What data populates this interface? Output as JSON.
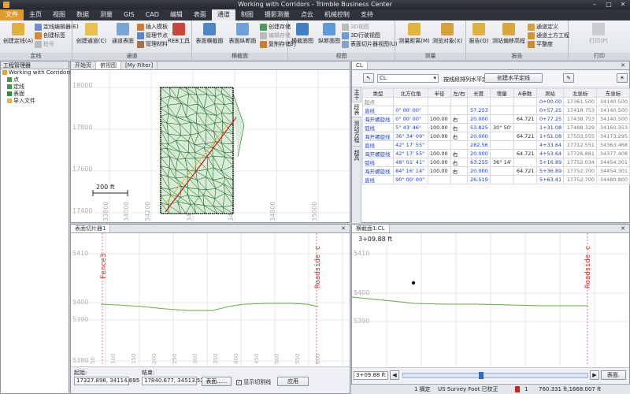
{
  "window": {
    "title": "Working with Corridors - Trimble Business Center"
  },
  "menu": {
    "file": "文件",
    "tabs": [
      "主页",
      "视图",
      "数据",
      "测量",
      "GIS",
      "CAD",
      "编辑",
      "表面",
      "通道",
      "制图",
      "摄影测量",
      "点云",
      "机械控制",
      "支持"
    ],
    "active": "通道"
  },
  "ribbon": {
    "groups": {
      "definition": "定线",
      "corridor": "通道",
      "cross_section": "横截面",
      "view": "视图",
      "survey": "测量",
      "report": "报告",
      "print": "打印"
    },
    "create_alignment": "创建定线(A)",
    "alignment_editor": "定线编辑器(E)",
    "create_label": "创建标签",
    "station": "桩号",
    "create_corridor": "创建通道(C)",
    "corridor_surface": "通道表面",
    "insert_template": "插入模板",
    "manage_nodes": "管理节点",
    "manage_materials": "管理材料",
    "reb_tool": "REB工具",
    "cs_view_surface": "表面横截面",
    "cs_view_corridor": "表面纵断面",
    "create_storage": "创建存储",
    "edit_storage": "编辑存储",
    "copy_storage": "复制存储的",
    "view_cross": "横截面图",
    "view_profile": "纵断面图",
    "view_3d": "3D视图",
    "view_3d_walk": "3D行驶视图",
    "view_surface_slice": "表面切片器视图(U)",
    "survey_distance": "测量距离(M)",
    "survey_target": "测览对象(X)",
    "report_btn": "报告(O)",
    "report_elevation": "测站偏移高程",
    "report_corridor_def": "通道定义",
    "report_earthworks": "通道土方工程",
    "report_flat": "平整度",
    "print_btn": "打印(P)"
  },
  "explorer": {
    "title": "工程管理器",
    "items": [
      "Working with Corridors",
      "点",
      "定线",
      "表面",
      "导入文件"
    ]
  },
  "plan_view": {
    "tabs": [
      "开始页",
      "俯视图",
      "[My Filter]"
    ],
    "scale_label": "200 ft",
    "y_ticks": [
      "18000",
      "17800",
      "17600",
      "17400"
    ],
    "x_ticks": [
      "33800",
      "34000",
      "34200",
      "34400",
      "34600",
      "34800",
      "35000"
    ]
  },
  "properties": {
    "tab": "CL",
    "alignment_selector": "CL",
    "sort_button": "按线段排列水平定线",
    "create_button": "创建水平定线",
    "side_tabs": [
      "主干",
      "段表",
      "测站方程",
      "超高"
    ],
    "columns": [
      "类型",
      "北方位角",
      "半径",
      "左/右",
      "长度",
      "增量",
      "A参数",
      "测站",
      "北坐标",
      "东坐标"
    ],
    "rows": [
      [
        "起点",
        "",
        "",
        "",
        "",
        "",
        "",
        "0+00.00",
        "17361.500",
        "34140.500"
      ],
      [
        "直线",
        "0° 00' 00\"",
        "",
        "",
        "57.253",
        "",
        "",
        "0+57.25",
        "17418.753",
        "34140.500"
      ],
      [
        "海开螺旋线",
        "0° 00' 00\"",
        "100.00",
        "右",
        "20.000",
        "",
        "64.721",
        "0+77.25",
        "17438.753",
        "34140.500"
      ],
      [
        "弧线",
        "5° 43' 46\"",
        "100.00",
        "右",
        "53.825",
        "30° 50'",
        "",
        "1+31.08",
        "17488.329",
        "34160.353"
      ],
      [
        "海开螺旋线",
        "36° 34' 09\"",
        "100.00",
        "右",
        "20.000",
        "",
        "64.721",
        "1+51.08",
        "17503.555",
        "34173.295"
      ],
      [
        "直线",
        "42° 17' 55\"",
        "",
        "",
        "282.56",
        "",
        "",
        "4+33.64",
        "17712.551",
        "34363.468"
      ],
      [
        "海开螺旋线",
        "42° 17' 55\"",
        "100.00",
        "右",
        "20.000",
        "",
        "64.721",
        "4+53.64",
        "17726.881",
        "34377.408"
      ],
      [
        "弧线",
        "48° 01' 41\"",
        "100.00",
        "右",
        "63.255",
        "36° 14'",
        "",
        "5+16.89",
        "17752.034",
        "34454.301"
      ],
      [
        "海开螺旋线",
        "84° 16' 14\"",
        "100.00",
        "右",
        "20.000",
        "",
        "64.721",
        "5+36.89",
        "17752.700",
        "34454.301"
      ],
      [
        "直线",
        "90° 00' 00\"",
        "",
        "",
        "26.519",
        "",
        "",
        "5+63.41",
        "17752.700",
        "34480.800"
      ]
    ]
  },
  "cross_section": {
    "tab": "表面切片器1",
    "y_ticks": [
      "5410",
      "5400",
      "5390",
      "5380"
    ],
    "x_ticks": [
      "50",
      "100",
      "150",
      "200",
      "250",
      "300",
      "350",
      "400",
      "450",
      "500",
      "550",
      "600"
    ],
    "left_label": "Fence3",
    "right_label": "Roadside c",
    "start_label": "起始:",
    "start_value": "17327.898, 34114.695",
    "end_label": "结束:",
    "end_value": "17840.677, 34513.525",
    "surface_button": "表面......",
    "show_cut_lines": "显示切割线",
    "apply_button": "应用"
  },
  "profile": {
    "tab": "横截面1:CL",
    "station_label": "3+09.88 ft",
    "y_ticks": [
      "5410",
      "5400",
      "5390"
    ],
    "right_label": "Roadside c",
    "station_field": "3+09.88 ft",
    "surface_button": "表面."
  },
  "status": {
    "selection": "1 摘定",
    "units": "US Survey Foot 已校正",
    "count": "1",
    "coords": "760.331 ft,1668.007 ft"
  },
  "colors": {
    "accent": "#e09a2a",
    "tin": "#1f6b2a",
    "alignment": "#d01818",
    "profile_line": "#6aa84f",
    "label_red": "#d83030"
  }
}
